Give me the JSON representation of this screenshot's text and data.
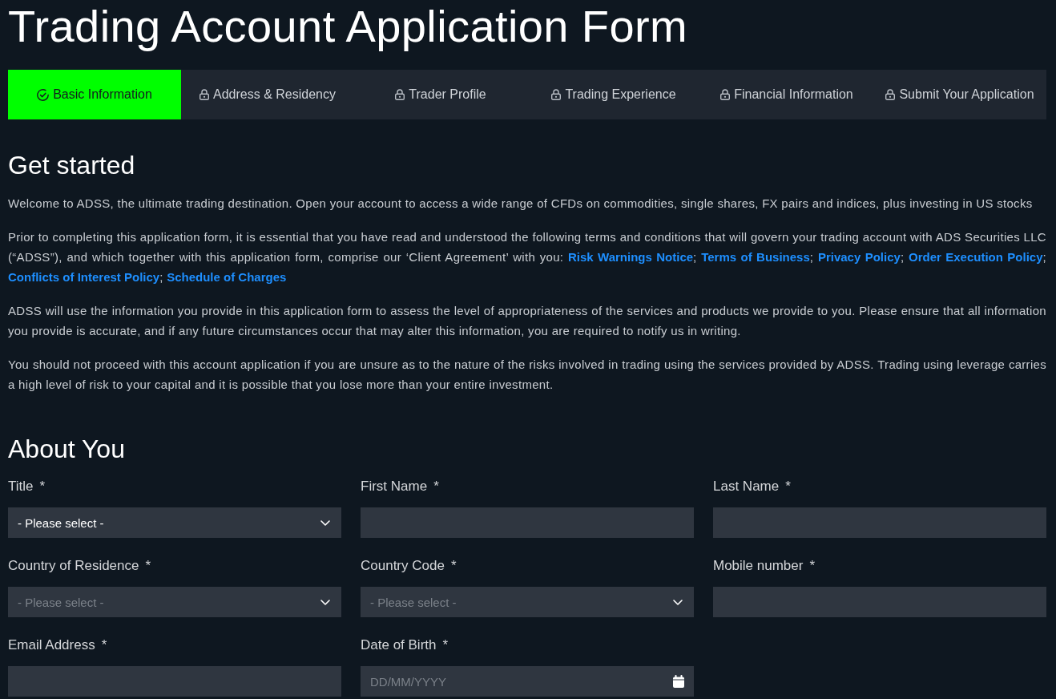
{
  "page": {
    "title": "Trading Account Application Form"
  },
  "steps": [
    {
      "label": "Basic Information",
      "selected": true,
      "locked": false
    },
    {
      "label": "Address & Residency",
      "selected": false,
      "locked": true
    },
    {
      "label": "Trader Profile",
      "selected": false,
      "locked": true
    },
    {
      "label": "Trading Experience",
      "selected": false,
      "locked": true
    },
    {
      "label": "Financial Information",
      "selected": false,
      "locked": true
    },
    {
      "label": "Submit Your Application",
      "selected": false,
      "locked": true
    }
  ],
  "intro": {
    "heading": "Get started",
    "paragraphs": [
      {
        "segments": [
          {
            "kind": "text",
            "text": "Welcome to ADSS, the ultimate trading destination. Open your account to access a wide range of CFDs on commodities, single shares, FX pairs and indices, plus investing in US stocks"
          }
        ]
      },
      {
        "segments": [
          {
            "kind": "text",
            "text": "Prior to completing this application form, it is essential that you have read and understood the following terms and conditions that will govern your trading account with ADS Securities LLC (“ADSS”), and which together with this application form, comprise our ‘Client Agreement’ with you: "
          },
          {
            "kind": "link",
            "text": "Risk Warnings Notice"
          },
          {
            "kind": "text",
            "text": "; "
          },
          {
            "kind": "link",
            "text": "Terms of Business"
          },
          {
            "kind": "text",
            "text": "; "
          },
          {
            "kind": "link",
            "text": "Privacy Policy"
          },
          {
            "kind": "text",
            "text": "; "
          },
          {
            "kind": "link",
            "text": "Order Execution Policy"
          },
          {
            "kind": "text",
            "text": "; "
          },
          {
            "kind": "link",
            "text": "Conflicts of Interest Policy"
          },
          {
            "kind": "text",
            "text": "; "
          },
          {
            "kind": "link",
            "text": "Schedule of Charges"
          }
        ]
      },
      {
        "segments": [
          {
            "kind": "text",
            "text": "ADSS will use the information you provide in this application form to assess the level of appropriateness of the services and products we provide to you. Please ensure that all information you provide is accurate, and if any future circumstances occur that may alter this information, you are required to notify us in writing."
          }
        ]
      },
      {
        "segments": [
          {
            "kind": "text",
            "text": "You should not proceed with this account application if you are unsure as to the nature of the risks involved in trading using the services provided by ADSS. Trading using leverage carries a high level of risk to your capital and it is possible that you lose more than your entire investment."
          }
        ]
      }
    ]
  },
  "about_you": {
    "heading": "About You",
    "fields": [
      {
        "kind": "select",
        "label": "Title",
        "required_mark": "*",
        "value": "- Please select -"
      },
      {
        "kind": "text",
        "label": "First Name",
        "required_mark": "*"
      },
      {
        "kind": "text",
        "label": "Last Name",
        "required_mark": "*"
      },
      {
        "kind": "select",
        "label": "Country of Residence",
        "required_mark": "*",
        "placeholder": "- Please select -"
      },
      {
        "kind": "select",
        "label": "Country Code",
        "required_mark": "*",
        "placeholder": "- Please select -"
      },
      {
        "kind": "text",
        "label": "Mobile number",
        "required_mark": "*"
      },
      {
        "kind": "text",
        "label": "Email Address",
        "required_mark": "*"
      },
      {
        "kind": "date",
        "label": "Date of Birth",
        "required_mark": "*",
        "placeholder": "DD/MM/YYYY"
      }
    ]
  }
}
